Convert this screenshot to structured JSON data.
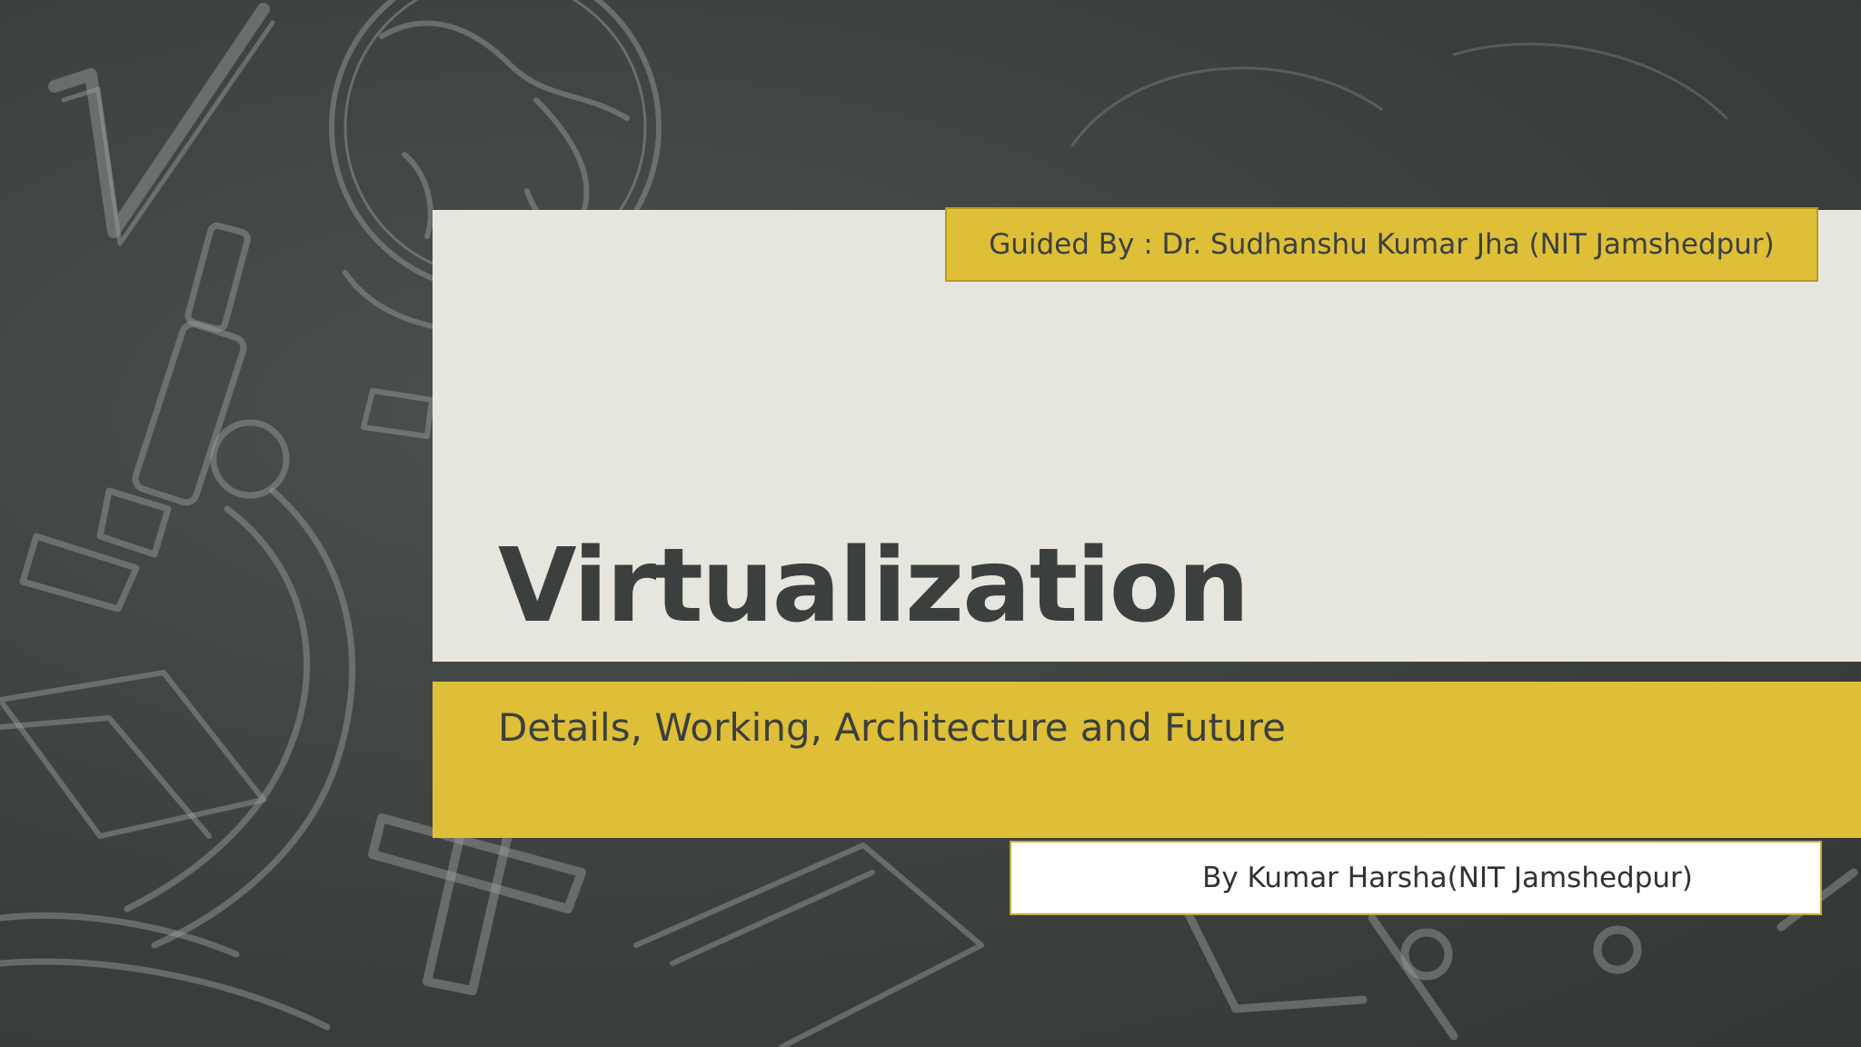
{
  "slide": {
    "title": "Virtualization",
    "subtitle": "Details, Working, Architecture and Future",
    "guide": "Guided By : Dr. Sudhanshu Kumar Jha (NIT Jamshedpur)",
    "author": "By Kumar Harsha(NIT Jamshedpur)",
    "decor_chalk": [
      "√",
      "%",
      "+",
      "÷",
      "∞"
    ]
  },
  "colors": {
    "chalkboard": "#3b403e",
    "panel": "#e6e6de",
    "accent": "#dfbf38",
    "text": "#3b403e"
  },
  "icons": {
    "background_art": [
      "globe-icon",
      "microscope-icon",
      "book-icon",
      "sqrt-icon",
      "plus-icon",
      "percent-icon"
    ]
  }
}
